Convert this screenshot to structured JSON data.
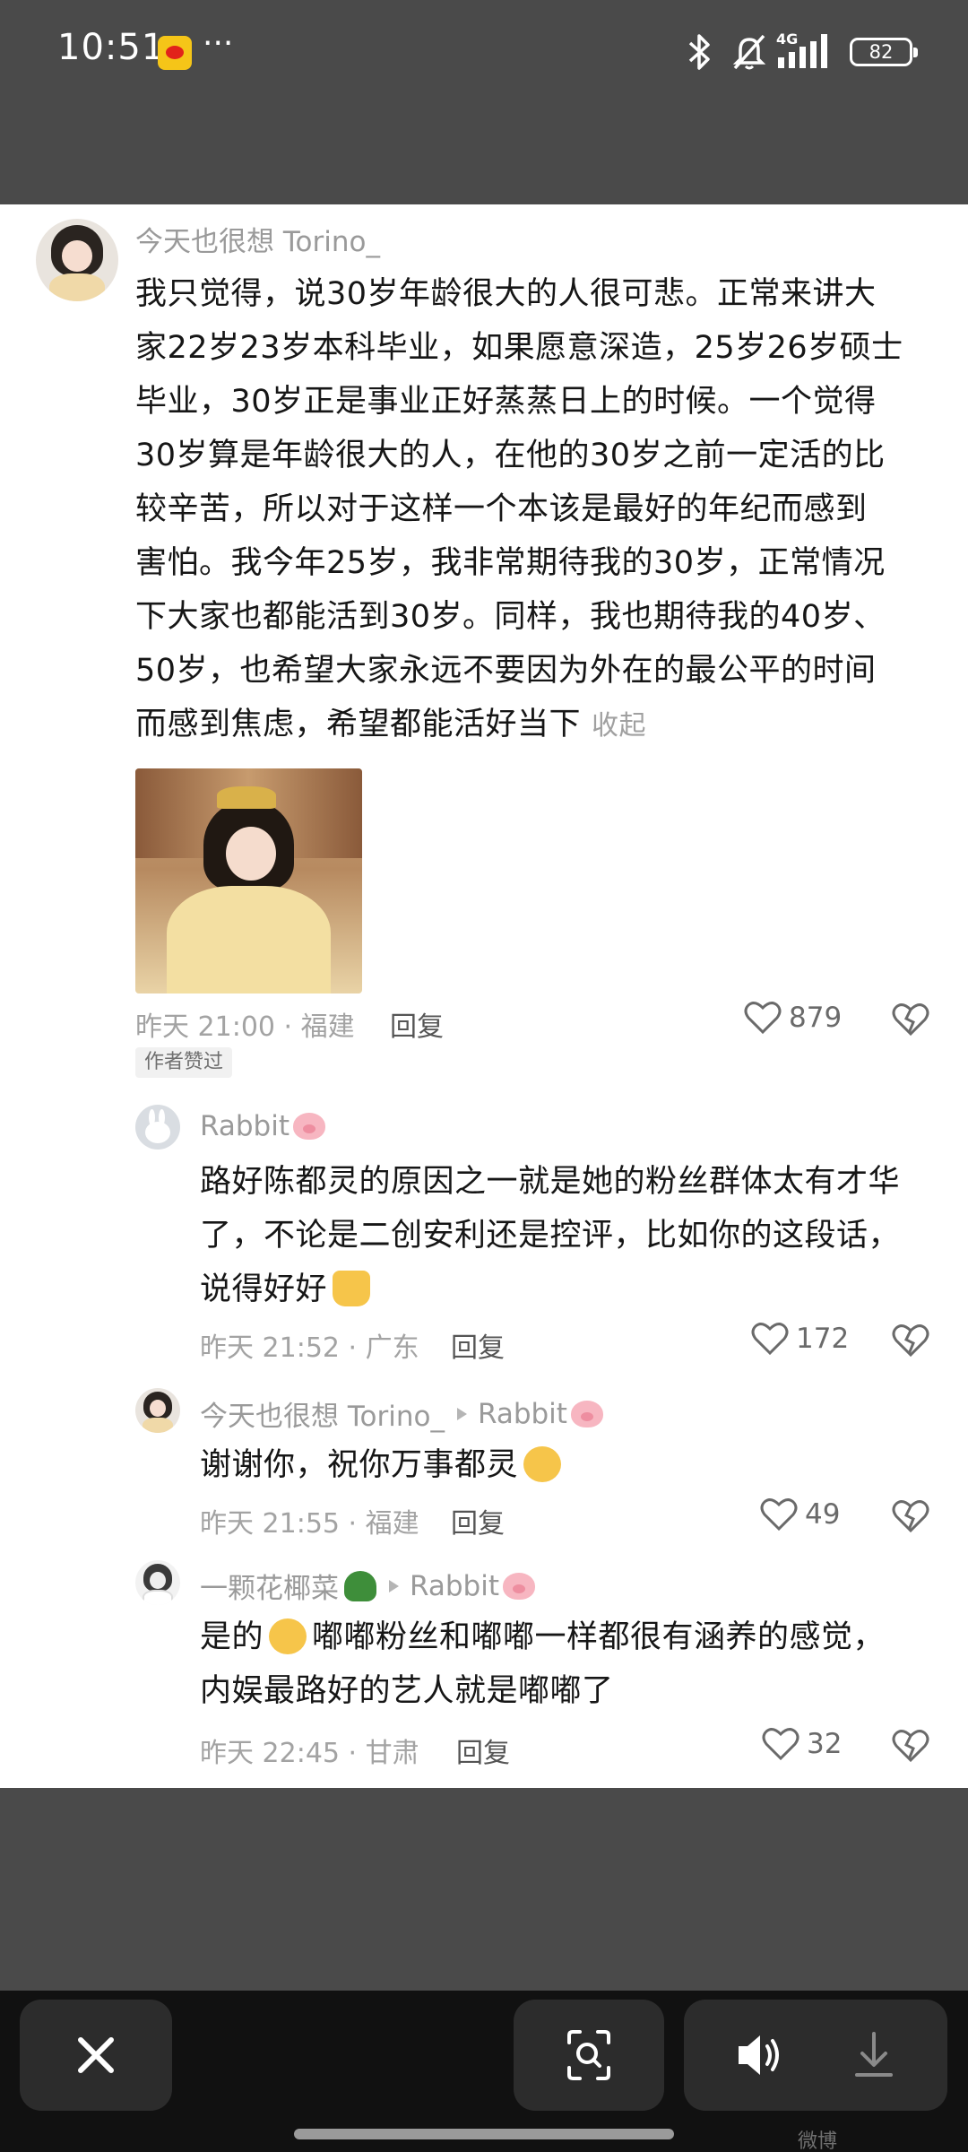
{
  "status_bar": {
    "time": "10:51",
    "more": "···",
    "network": "4G",
    "battery": "82"
  },
  "comments": [
    {
      "username": "今天也很想 Torino_",
      "text": "我只觉得，说30岁年龄很大的人很可悲。正常来讲大\n家22岁23岁本科毕业，如果愿意深造，25岁26岁硕士\n毕业，30岁正是事业正好蒸蒸日上的时候。一个觉得\n30岁算是年龄很大的人，在他的30岁之前一定活的比\n较辛苦，所以对于这样一个本该是最好的年纪而感到\n害怕。我今年25岁，我非常期待我的30岁，正常情况\n下大家也都能活到30岁。同样，我也期待我的40岁、\n50岁，也希望大家永远不要因为外在的最公平的时间\n而感到焦虑，希望都能活好当下",
      "fold": "收起",
      "meta": "昨天 21:00 · 福建",
      "reply": "回复",
      "likes": "879",
      "badge": "作者赞过"
    },
    {
      "username": "Rabbit",
      "text": "路好陈都灵的原因之一就是她的粉丝群体太有才华\n了，不论是二创安利还是控评，比如你的这段话，\n说得好好",
      "meta": "昨天 21:52 · 广东",
      "reply": "回复",
      "likes": "172"
    },
    {
      "username": "今天也很想 Torino_",
      "reply_to": "Rabbit",
      "text": "谢谢你，祝你万事都灵",
      "meta": "昨天 21:55 · 福建",
      "reply": "回复",
      "likes": "49"
    },
    {
      "username": "一颗花椰菜",
      "reply_to": "Rabbit",
      "text_a": "是的",
      "text_b": "嘟嘟粉丝和嘟嘟一样都很有涵养的感觉，\n内娱最路好的艺人就是嘟嘟了",
      "meta": "昨天 22:45 · 甘肃",
      "reply": "回复",
      "likes": "32"
    }
  ],
  "icons": {
    "like": "heart-outline-icon",
    "dislike": "broken-heart-icon",
    "close": "close-icon",
    "lens": "scan-icon",
    "sound": "speaker-icon",
    "download": "download-icon"
  },
  "watermark": "微博"
}
